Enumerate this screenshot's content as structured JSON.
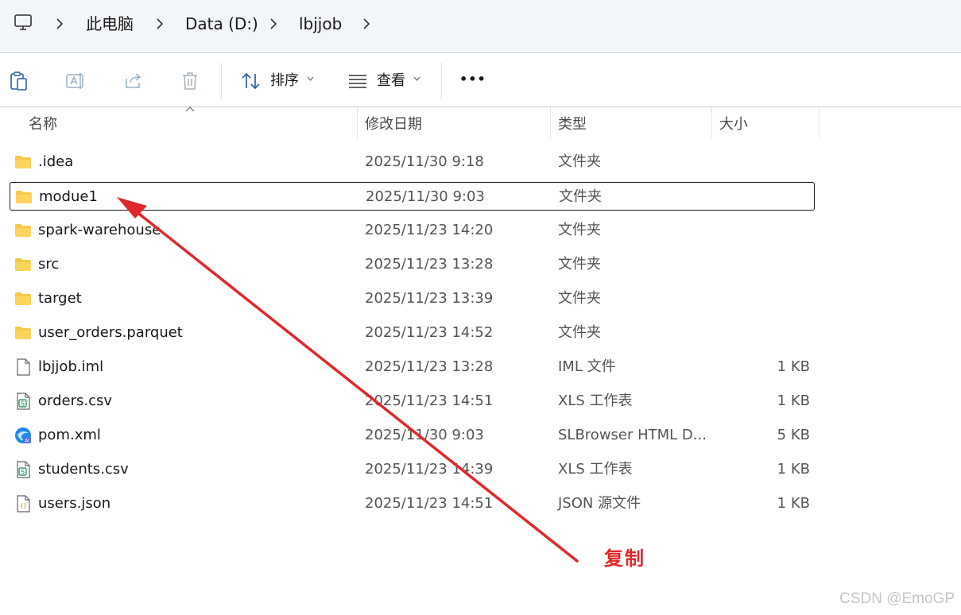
{
  "address_bar": {
    "crumbs": [
      "此电脑",
      "Data (D:)",
      "lbjjob"
    ]
  },
  "toolbar": {
    "icons": [
      "clipboard-icon",
      "rename-icon",
      "share-icon",
      "delete-icon"
    ],
    "sort_label": "排序",
    "view_label": "查看",
    "more_label": "•••"
  },
  "columns": {
    "name": "名称",
    "date": "修改日期",
    "type": "类型",
    "size": "大小"
  },
  "files": [
    {
      "name": ".idea",
      "date": "2025/11/30 9:18",
      "type": "文件夹",
      "size": "",
      "icon": "folder-icon"
    },
    {
      "name": "modue1",
      "date": "2025/11/30 9:03",
      "type": "文件夹",
      "size": "",
      "icon": "folder-icon"
    },
    {
      "name": "spark-warehouse",
      "date": "2025/11/23 14:20",
      "type": "文件夹",
      "size": "",
      "icon": "folder-icon"
    },
    {
      "name": "src",
      "date": "2025/11/23 13:28",
      "type": "文件夹",
      "size": "",
      "icon": "folder-icon"
    },
    {
      "name": "target",
      "date": "2025/11/23 13:39",
      "type": "文件夹",
      "size": "",
      "icon": "folder-icon"
    },
    {
      "name": "user_orders.parquet",
      "date": "2025/11/23 14:52",
      "type": "文件夹",
      "size": "",
      "icon": "folder-icon"
    },
    {
      "name": "lbjjob.iml",
      "date": "2025/11/23 13:28",
      "type": "IML 文件",
      "size": "1 KB",
      "icon": "file-icon"
    },
    {
      "name": "orders.csv",
      "date": "2025/11/23 14:51",
      "type": "XLS 工作表",
      "size": "1 KB",
      "icon": "spreadsheet-icon"
    },
    {
      "name": "pom.xml",
      "date": "2025/11/30 9:03",
      "type": "SLBrowser HTML D...",
      "size": "5 KB",
      "icon": "browser-icon"
    },
    {
      "name": "students.csv",
      "date": "2025/11/23 14:39",
      "type": "XLS 工作表",
      "size": "1 KB",
      "icon": "spreadsheet-icon"
    },
    {
      "name": "users.json",
      "date": "2025/11/23 14:51",
      "type": "JSON 源文件",
      "size": "1 KB",
      "icon": "json-icon"
    }
  ],
  "selected_index": 1,
  "annotation": {
    "label": "复制",
    "color": "#e0282c"
  },
  "watermark": "CSDN @EmoGP"
}
